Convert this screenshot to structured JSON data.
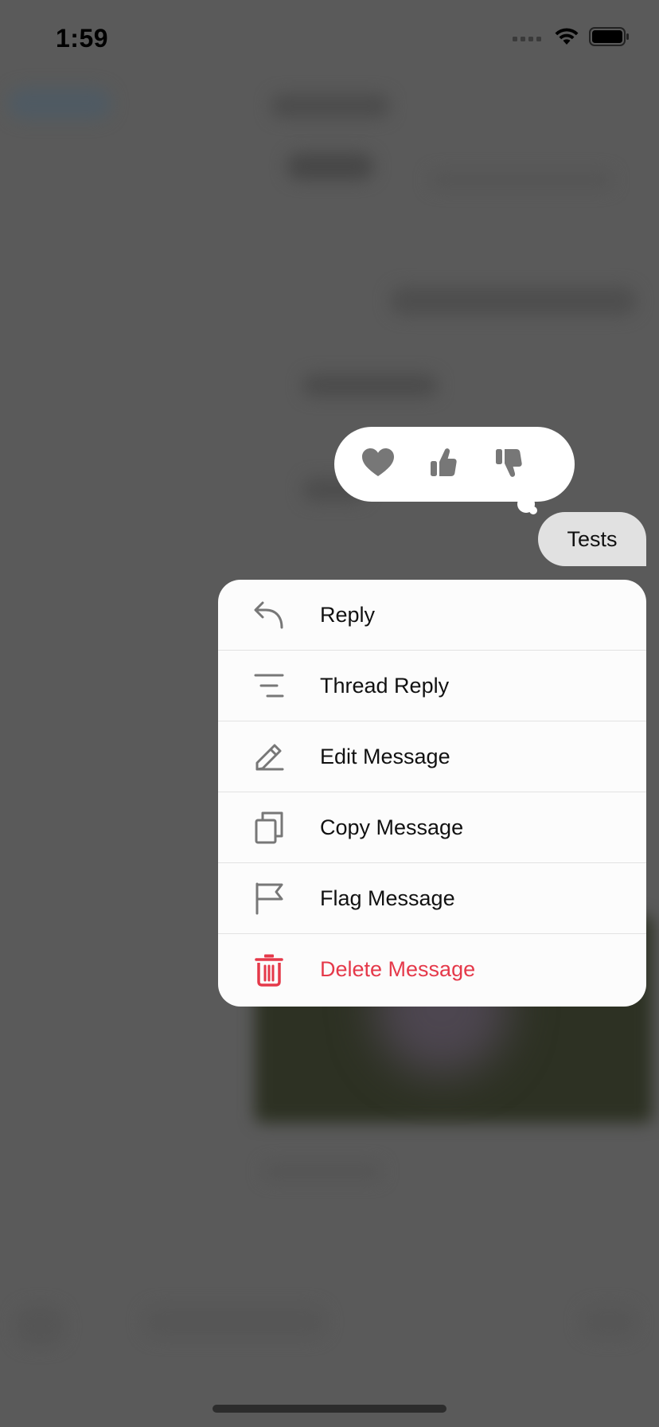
{
  "status_bar": {
    "time": "1:59",
    "icons": [
      "signal-icon",
      "wifi-icon",
      "battery-icon"
    ]
  },
  "reactions": [
    {
      "icon": "heart-icon"
    },
    {
      "icon": "thumbs-up-icon"
    },
    {
      "icon": "thumbs-down-icon"
    }
  ],
  "message": {
    "text": "Tests"
  },
  "menu": {
    "items": [
      {
        "label": "Reply",
        "icon": "reply-icon"
      },
      {
        "label": "Thread Reply",
        "icon": "thread-reply-icon"
      },
      {
        "label": "Edit Message",
        "icon": "pencil-icon"
      },
      {
        "label": "Copy Message",
        "icon": "copy-icon"
      },
      {
        "label": "Flag Message",
        "icon": "flag-icon"
      },
      {
        "label": "Delete Message",
        "icon": "trash-icon"
      }
    ]
  },
  "colors": {
    "danger": "#e5394a",
    "icon_gray": "#7a7a7a",
    "overlay": "#5a5a5a"
  }
}
